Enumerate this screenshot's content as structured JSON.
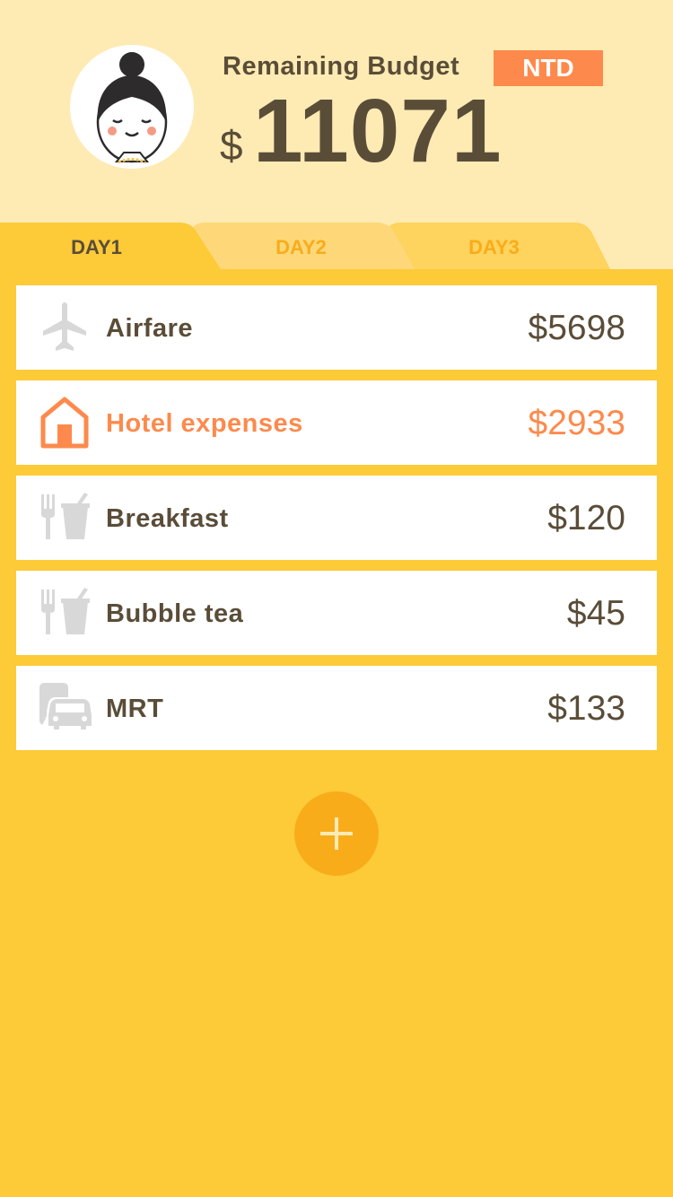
{
  "header": {
    "label": "Remaining Budget",
    "currency": "NTD",
    "currency_symbol": "$",
    "amount": "11071"
  },
  "tabs": [
    {
      "label": "DAY1",
      "active": true
    },
    {
      "label": "DAY2",
      "active": false
    },
    {
      "label": "DAY3",
      "active": false
    }
  ],
  "expenses": [
    {
      "icon": "airplane-icon",
      "label": "Airfare",
      "amount": "$5698"
    },
    {
      "icon": "house-icon",
      "label": "Hotel expenses",
      "amount": "$2933",
      "highlighted": true
    },
    {
      "icon": "food-drink-icon",
      "label": "Breakfast",
      "amount": "$120"
    },
    {
      "icon": "food-drink-icon",
      "label": "Bubble tea",
      "amount": "$45"
    },
    {
      "icon": "transport-icon",
      "label": "MRT",
      "amount": "$133"
    }
  ],
  "colors": {
    "header_bg": "#feebb4",
    "page_bg": "#fdca38",
    "accent": "#fd8a4c",
    "text": "#5a4d38",
    "inactive_tab_text": "#f9ac1a",
    "icon_gray": "#d8d8d8"
  }
}
